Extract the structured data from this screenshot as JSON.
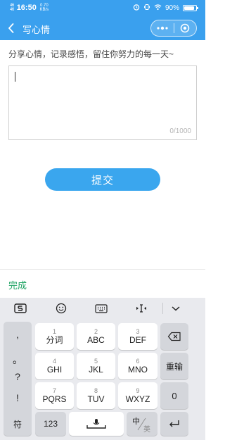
{
  "status": {
    "signal_top": "46",
    "signal_bottom": "46",
    "time": "16:50",
    "net_speed_value": "0.70",
    "net_speed_unit": "KB/s",
    "battery": "90%",
    "battery_level": 0.9
  },
  "nav": {
    "title": "写心情"
  },
  "main": {
    "prompt": "分享心情，记录感悟，留住你努力的每一天~",
    "counter": "0/1000",
    "submit_label": "提交"
  },
  "done_label": "完成",
  "keyboard": {
    "punctuation": [
      ",",
      "。",
      "?",
      "!"
    ],
    "keys": [
      {
        "num": "1",
        "label": "分词"
      },
      {
        "num": "2",
        "label": "ABC"
      },
      {
        "num": "3",
        "label": "DEF"
      },
      {
        "num": "4",
        "label": "GHI"
      },
      {
        "num": "5",
        "label": "JKL"
      },
      {
        "num": "6",
        "label": "MNO"
      },
      {
        "num": "7",
        "label": "PQRS"
      },
      {
        "num": "8",
        "label": "TUV"
      },
      {
        "num": "9",
        "label": "WXYZ"
      }
    ],
    "reinput_label": "重输",
    "zero_label": "0",
    "symbol_label": "符",
    "num_label": "123",
    "lang_zh": "中",
    "lang_en": "英"
  },
  "colors": {
    "header": "#3aa0ee",
    "submit": "#3aa6ee",
    "done": "#1aa260"
  }
}
